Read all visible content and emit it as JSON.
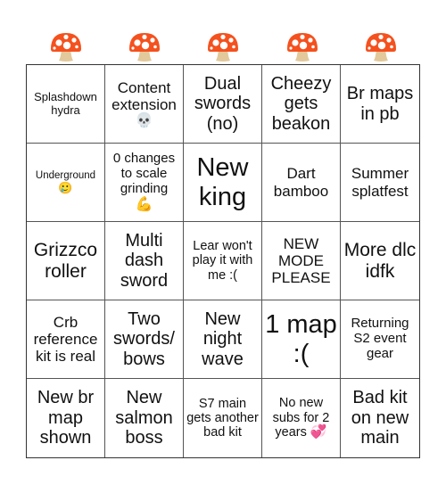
{
  "header": {
    "icon": "mushroom-icon",
    "icon_glyph": "🍄",
    "count": 5,
    "colors": {
      "cap": "#f4511e",
      "spots": "#ffffff",
      "stem": "#e2c89a"
    }
  },
  "board": {
    "rows": [
      [
        {
          "text": "Splashdown hydra"
        },
        {
          "text": "Content extension",
          "emoji": "💀",
          "emoji_name": "skull-icon"
        },
        {
          "text": "Dual swords (no)"
        },
        {
          "text": "Cheezy gets beakon"
        },
        {
          "text": "Br maps in pb"
        }
      ],
      [
        {
          "text": "Underground",
          "emoji": "🥲",
          "emoji_name": "smiling-face-with-tear-icon"
        },
        {
          "text": "0 changes to scale grinding",
          "emoji": "💪",
          "emoji_name": "flexed-biceps-icon"
        },
        {
          "text": "New king"
        },
        {
          "text": "Dart bamboo"
        },
        {
          "text": "Summer splatfest"
        }
      ],
      [
        {
          "text": "Grizzco roller"
        },
        {
          "text": "Multi dash sword"
        },
        {
          "text": "Lear won't play it with me :("
        },
        {
          "text": "NEW MODE PLEASE"
        },
        {
          "text": "More dlc idfk"
        }
      ],
      [
        {
          "text": "Crb reference kit is real"
        },
        {
          "text": "Two swords/ bows"
        },
        {
          "text": "New night wave"
        },
        {
          "text": "1 map :("
        },
        {
          "text": "Returning S2 event gear"
        }
      ],
      [
        {
          "text": "New br map shown"
        },
        {
          "text": "New salmon boss"
        },
        {
          "text": "S7 main gets another bad kit"
        },
        {
          "text": "No new subs for 2 years",
          "emoji": "💞",
          "emoji_name": "revolving-hearts-icon"
        },
        {
          "text": "Bad kit on new main"
        }
      ]
    ]
  }
}
